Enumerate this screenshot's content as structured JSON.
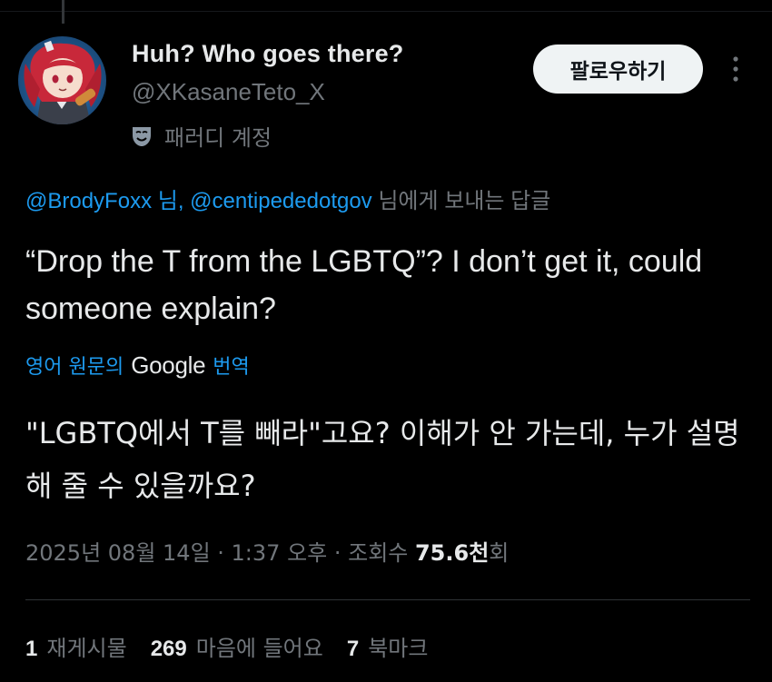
{
  "author": {
    "display_name": "Huh? Who goes there?",
    "handle": "@XKasaneTeto_X",
    "parody_label": "패러디 계정",
    "avatar_icon": "anime-character-avatar"
  },
  "follow_button": {
    "label": "팔로우하기"
  },
  "reply_context": {
    "mention_1": "@BrodyFoxx",
    "suffix_1": " 님, ",
    "mention_2": "@centipededotgov",
    "suffix_2": " 님에게 보내는 답글"
  },
  "tweet": {
    "text": "“Drop the T from the LGBTQ”? I don’t get it, could someone explain?",
    "translate_prefix": "영어 원문의",
    "translate_provider": "Google",
    "translate_action": "번역",
    "translated_text": "\"LGBTQ에서 T를 빼라\"고요? 이해가 안 가는데, 누가 설명해 줄 수 있을까요?"
  },
  "meta": {
    "datetime": "2025년 08월 14일 · 1:37 오후 · 조회수 ",
    "views": "75.6천",
    "views_suffix": "회"
  },
  "stats": {
    "reposts_count": "1",
    "reposts_label": "재게시물",
    "likes_count": "269",
    "likes_label": "마음에 들어요",
    "bookmarks_count": "7",
    "bookmarks_label": "북마크"
  },
  "colors": {
    "background": "#000000",
    "text": "#e7e9ea",
    "secondary": "#71767b",
    "accent": "#1d9bf0"
  }
}
